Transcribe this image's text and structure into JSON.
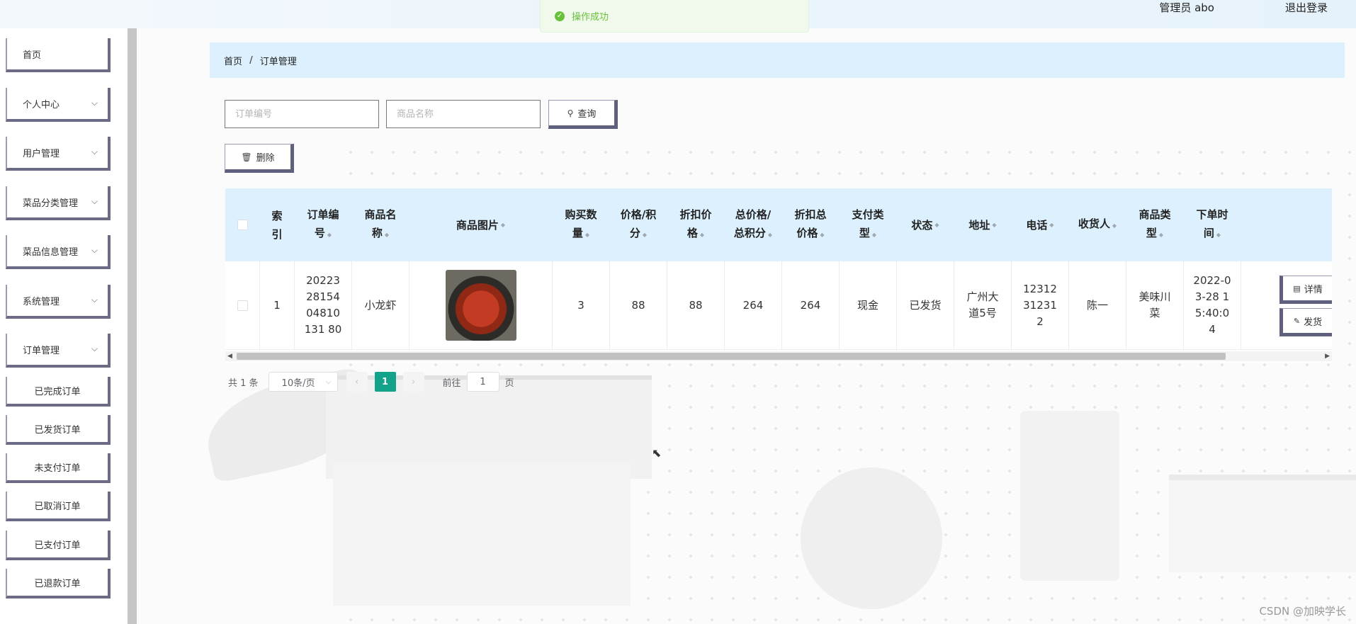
{
  "header": {
    "user": "管理员 abo",
    "logout": "退出登录"
  },
  "toast": {
    "text": "操作成功"
  },
  "sidebar": {
    "items": [
      {
        "label": "首页"
      },
      {
        "label": "个人中心"
      },
      {
        "label": "用户管理"
      },
      {
        "label": "菜品分类管理"
      },
      {
        "label": "菜品信息管理"
      },
      {
        "label": "系统管理"
      },
      {
        "label": "订单管理"
      }
    ],
    "sub_items": [
      {
        "label": "已完成订单"
      },
      {
        "label": "已发货订单"
      },
      {
        "label": "未支付订单"
      },
      {
        "label": "已取消订单"
      },
      {
        "label": "已支付订单"
      },
      {
        "label": "已退款订单"
      }
    ]
  },
  "breadcrumb": {
    "home": "首页",
    "separator": "/",
    "current": "订单管理"
  },
  "search": {
    "order_no_placeholder": "订单编号",
    "goods_name_placeholder": "商品名称",
    "query_label": "查询"
  },
  "toolbar": {
    "delete_label": "删除"
  },
  "table": {
    "headers": {
      "index": "索引",
      "order_no": "订单编号",
      "goods_name": "商品名称",
      "goods_image": "商品图片",
      "qty": "购买数量",
      "price": "价格/积分",
      "discount_price": "折扣价格",
      "total": "总价格/总积分",
      "discount_total": "折扣总价格",
      "pay_type": "支付类型",
      "status": "状态",
      "address": "地址",
      "phone": "电话",
      "receiver": "收货人",
      "goods_type": "商品类型",
      "order_time": "下单时间"
    },
    "rows": [
      {
        "index": "1",
        "order_no": "202232815404810131 80",
        "goods_name": "小龙虾",
        "goods_image": "crayfish-dish-image",
        "qty": "3",
        "price": "88",
        "discount_price": "88",
        "total": "264",
        "discount_total": "264",
        "pay_type": "现金",
        "status": "已发货",
        "address": "广州大道5号",
        "phone": "12312312312",
        "receiver": "陈一",
        "goods_type": "美味川菜",
        "order_time": "2022-03-28 15:40:04",
        "detail_label": "详情",
        "ship_label": "发货"
      }
    ]
  },
  "pagination": {
    "total": "共 1 条",
    "page_size": "10条/页",
    "current_page": "1",
    "goto_label": "前往",
    "goto_value": "1",
    "page_suffix": "页"
  },
  "watermark": "CSDN @加映学长",
  "colors": {
    "header_bg": "#dcf0fd",
    "accent": "#13a38a",
    "toast_green": "#67c23a",
    "menu_border": "#6b6b86"
  }
}
